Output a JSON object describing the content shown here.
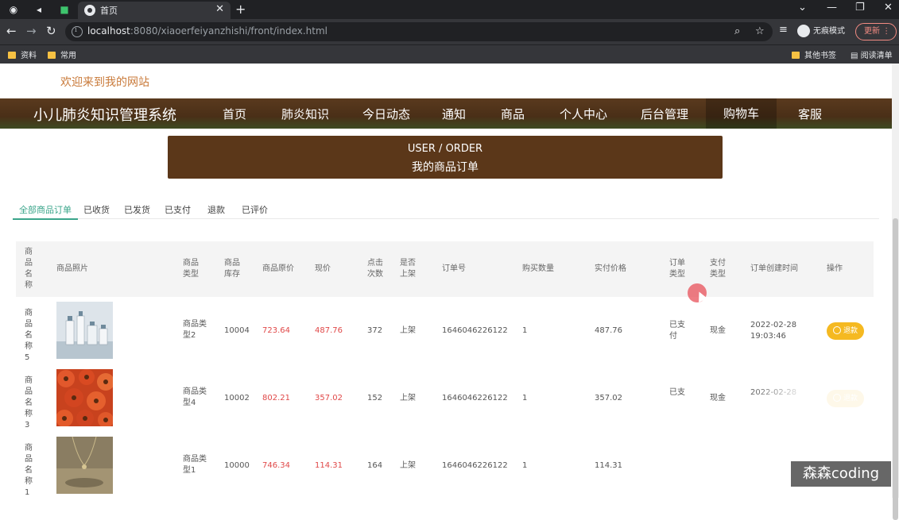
{
  "browser": {
    "tab_title": "首页",
    "url_host": "localhost",
    "url_rest": ":8080/xiaoerfeiyanzhishi/front/index.html",
    "incognito_label": "无痕模式",
    "update_label": "更新",
    "bookmarks": [
      "资料",
      "常用"
    ],
    "bookmarks_right": [
      "其他书签",
      "阅读清单"
    ]
  },
  "page": {
    "welcome": "欢迎来到我的网站",
    "site_title": "小儿肺炎知识管理系统",
    "nav": [
      "首页",
      "肺炎知识",
      "今日动态",
      "通知",
      "商品",
      "个人中心",
      "后台管理",
      "购物车",
      "客服"
    ],
    "nav_active": "购物车",
    "banner_en": "USER / ORDER",
    "banner_zh": "我的商品订单",
    "order_tabs": [
      "全部商品订单",
      "已收货",
      "已发货",
      "已支付",
      "退款",
      "已评价"
    ],
    "active_tab": "全部商品订单"
  },
  "table": {
    "headers": [
      "商品名称",
      "商品照片",
      "商品类型",
      "商品库存",
      "商品原价",
      "现价",
      "点击次数",
      "是否上架",
      "订单号",
      "购买数量",
      "实付价格",
      "订单类型",
      "支付类型",
      "订单创建时间",
      "操作"
    ],
    "rows": [
      {
        "name": "商品名称5",
        "type": "商品类型2",
        "stock": "10004",
        "orig": "723.64",
        "price": "487.76",
        "clicks": "372",
        "status": "上架",
        "order_no": "1646046226122",
        "qty": "1",
        "paid": "487.76",
        "otype": "已支付",
        "ptype": "现金",
        "created": "2022-02-28 19:03:46",
        "action": "退款"
      },
      {
        "name": "商品名称3",
        "type": "商品类型4",
        "stock": "10002",
        "orig": "802.21",
        "price": "357.02",
        "clicks": "152",
        "status": "上架",
        "order_no": "1646046226122",
        "qty": "1",
        "paid": "357.02",
        "otype": "已支",
        "ptype": "现金",
        "created": "2022-02-28",
        "action": "退款"
      },
      {
        "name": "商品名称1",
        "type": "商品类型1",
        "stock": "10000",
        "orig": "746.34",
        "price": "114.31",
        "clicks": "164",
        "status": "上架",
        "order_no": "1646046226122",
        "qty": "1",
        "paid": "114.31",
        "otype": "",
        "ptype": "",
        "created": "",
        "action": ""
      }
    ]
  },
  "watermark": "森森coding",
  "colors": {
    "header_bg": "#4a2f17",
    "banner_bg": "#5b3719",
    "accent": "#3aa58a",
    "price_red": "#e04848",
    "refund_btn": "#f5b921"
  }
}
